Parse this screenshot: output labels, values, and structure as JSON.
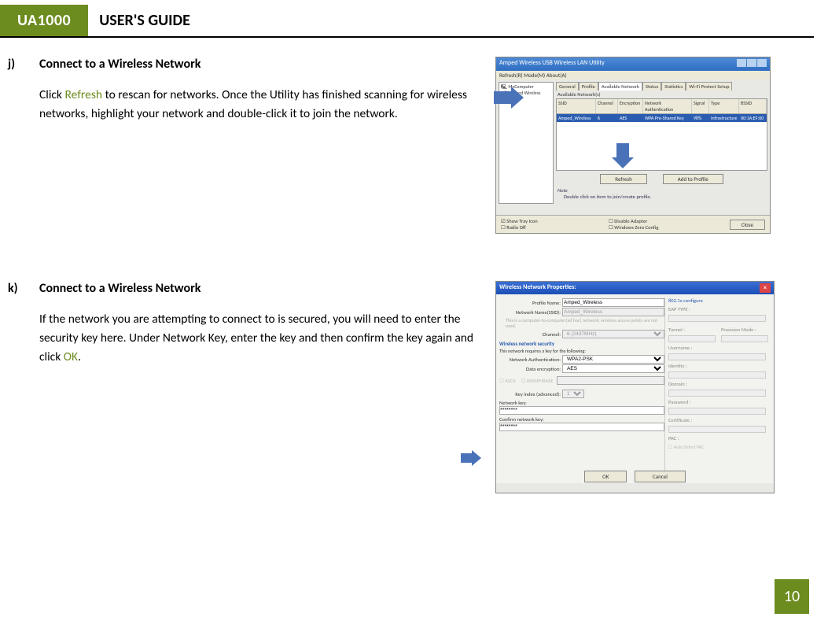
{
  "header": {
    "badge": "UA1000",
    "title": "USER'S GUIDE"
  },
  "page_number": "10",
  "sections": {
    "j": {
      "marker": "j)",
      "heading": "Connect to a Wireless Network",
      "body_pre": "Click ",
      "body_hl": "Refresh",
      "body_post": " to rescan for networks. Once the Utility has finished scanning for wireless networks, highlight your network and double-click it to join the network."
    },
    "k": {
      "marker": "k)",
      "heading": "Connect to a Wireless Network",
      "body_pre": "If the network you are attempting to connect to is secured, you will need to enter the security key here.  Under Network Key, enter the key and then confirm the key again and click ",
      "body_hl": "OK",
      "body_post": "."
    }
  },
  "fig1": {
    "title": "Amped Wireless USB Wireless LAN Utility",
    "menu": "Refresh(R)   Mode(M)   About(A)",
    "tree_root": "MyComputer",
    "tree_child": "Amped Wireless",
    "tabs": [
      "General",
      "Profile",
      "Available Network",
      "Status",
      "Statistics",
      "Wi-Fi Protect Setup"
    ],
    "active_tab": 2,
    "avail_label": "Available Network(s)",
    "columns": [
      "SSID",
      "Channel",
      "Encryption",
      "Network Authentication",
      "Signal",
      "Type",
      "BSSID"
    ],
    "row": {
      "ssid": "Amped_Wireless",
      "ch": "6",
      "enc": "AES",
      "auth": "WPA Pre-Shared Key",
      "sig": "98%",
      "type": "Infrastructure",
      "bssid": "00:1A:EF:00"
    },
    "btn_refresh": "Refresh",
    "btn_add": "Add to Profile",
    "note_label": "Note",
    "note_text": "Double click on item to join/create profile.",
    "chk_tray": "Show Tray Icon",
    "chk_radio": "Radio Off",
    "chk_disable": "Disable Adapter",
    "chk_zero": "Windows Zero Config",
    "btn_close": "Close"
  },
  "fig2": {
    "title": "Wireless Network Properties:",
    "profile_name_lbl": "Profile Name:",
    "profile_name": "Amped_Wireless",
    "ssid_lbl": "Network Name(SSID):",
    "ssid": "Amped_Wireless",
    "adhoc_hint": "This is a computer-to-computer(ad hoc) network; wireless access points are not used.",
    "channel_lbl": "Channel:",
    "channel": "6  (2437MHz)",
    "sec_title": "Wireless network security",
    "sec_hint": "This network requires a key for the following:",
    "auth_lbl": "Network Authentication:",
    "auth": "WPA2-PSK",
    "enc_lbl": "Data encryption:",
    "enc": "AES",
    "ascii": "ASCII",
    "pass_lbl": "PASSPHRASE",
    "keyidx_lbl": "Key index (advanced):",
    "keyidx": "1",
    "netkey_lbl": "Network key:",
    "netkey": "********",
    "confkey_lbl": "Confirm network key:",
    "confkey": "********",
    "btn_ok": "OK",
    "btn_cancel": "Cancel",
    "r8021x": "802.1x configure",
    "r_eap": "EAP TYPE :",
    "r_tunnel": "Tunnel :",
    "r_provision": "Provision Mode :",
    "r_user": "Username :",
    "r_identity": "Identity :",
    "r_domain": "Domain :",
    "r_password": "Password :",
    "r_cert": "Certificate :",
    "r_pac": "PAC :",
    "r_autopac": "Auto Select PAC"
  }
}
